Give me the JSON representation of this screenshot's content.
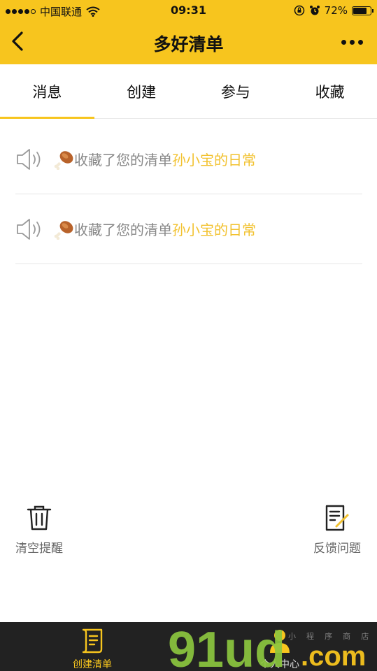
{
  "status_bar": {
    "carrier": "中国联通",
    "time": "09:31",
    "battery_percent": "72%",
    "battery_level": 0.72
  },
  "navbar": {
    "title": "多好清单",
    "back_icon": "chevron-left-icon",
    "more_icon": "more-dots-icon"
  },
  "tabs": [
    {
      "label": "消息",
      "active": true
    },
    {
      "label": "创建",
      "active": false
    },
    {
      "label": "参与",
      "active": false
    },
    {
      "label": "收藏",
      "active": false
    }
  ],
  "messages": [
    {
      "text": "收藏了您的清单",
      "list_name": "孙小宝的日常",
      "icon": "speaker-icon",
      "avatar": "drumstick-icon"
    },
    {
      "text": "收藏了您的清单",
      "list_name": "孙小宝的日常",
      "icon": "speaker-icon",
      "avatar": "drumstick-icon"
    }
  ],
  "actions": {
    "clear": {
      "label": "清空提醒",
      "icon": "trash-icon"
    },
    "feedback": {
      "label": "反馈问题",
      "icon": "edit-note-icon"
    }
  },
  "tabbar": [
    {
      "label": "创建清单",
      "icon": "scroll-icon",
      "active": true
    },
    {
      "label": "个人中心",
      "icon": "person-icon",
      "active": false
    }
  ],
  "watermark": {
    "text": "91ud.com",
    "subtext": "小 程 序 商 店"
  },
  "colors": {
    "accent": "#f7c51e",
    "link": "#f2c230",
    "tabbar_bg": "#222222",
    "muted_text": "#888888"
  }
}
